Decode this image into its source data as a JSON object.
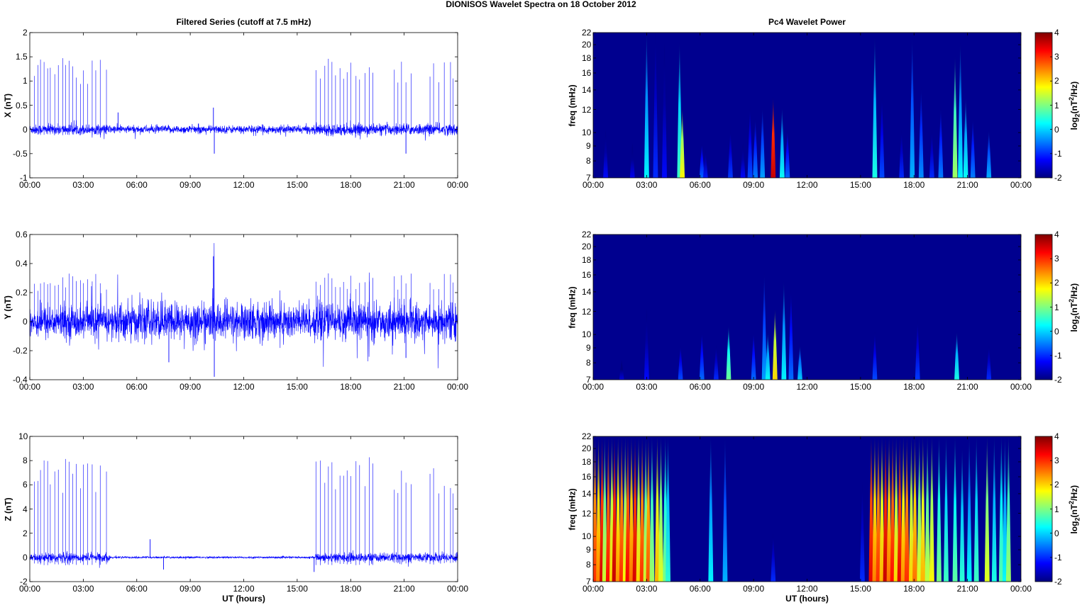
{
  "figure_title": "DIONISOS Wavelet Spectra on 18 October   2012",
  "colors": {
    "trace": "#0000ff",
    "background_power": "#00008f"
  },
  "chart_data": [
    {
      "type": "line",
      "id": "x_series",
      "title": "Filtered Series (cutoff at 7.5 mHz)",
      "xlabel": "",
      "ylabel": "X (nT)",
      "xlim": [
        0,
        24
      ],
      "ylim": [
        -1,
        2
      ],
      "yticks": [
        "-1",
        "-0.5",
        "0",
        "0.5",
        "1",
        "1.5",
        "2"
      ],
      "ytick_values": [
        -1,
        -0.5,
        0,
        0.5,
        1,
        1.5,
        2
      ],
      "xticks": [
        "00:00",
        "03:00",
        "06:00",
        "09:00",
        "12:00",
        "15:00",
        "18:00",
        "21:00",
        "00:00"
      ],
      "noise_sd": [
        [
          0,
          4.5,
          0.05
        ],
        [
          4.5,
          16,
          0.04
        ],
        [
          16,
          24,
          0.055
        ]
      ],
      "spike_scale": 1.25,
      "extra_spikes": [
        [
          4.95,
          0.35
        ],
        [
          10.3,
          0.45
        ],
        [
          10.35,
          -0.5
        ],
        [
          21.1,
          -0.5
        ]
      ]
    },
    {
      "type": "line",
      "id": "y_series",
      "title": "",
      "xlabel": "",
      "ylabel": "Y (nT)",
      "xlim": [
        0,
        24
      ],
      "ylim": [
        -0.4,
        0.6
      ],
      "yticks": [
        "-0.4",
        "-0.2",
        "0",
        "0.2",
        "0.4",
        "0.6"
      ],
      "ytick_values": [
        -0.4,
        -0.2,
        0,
        0.2,
        0.4,
        0.6
      ],
      "xticks": [
        "00:00",
        "03:00",
        "06:00",
        "09:00",
        "12:00",
        "15:00",
        "18:00",
        "21:00",
        "00:00"
      ],
      "noise_sd": [
        [
          0,
          4.5,
          0.055
        ],
        [
          4.5,
          16,
          0.065
        ],
        [
          16,
          24,
          0.06
        ]
      ],
      "spike_scale": 0.28,
      "extra_spikes": [
        [
          10.3,
          0.45
        ],
        [
          10.35,
          -0.38
        ],
        [
          7.8,
          -0.28
        ],
        [
          21.1,
          -0.25
        ]
      ]
    },
    {
      "type": "line",
      "id": "z_series",
      "title": "",
      "xlabel": "UT (hours)",
      "ylabel": "Z (nT)",
      "xlim": [
        0,
        24
      ],
      "ylim": [
        -2,
        10
      ],
      "yticks": [
        "-2",
        "0",
        "2",
        "4",
        "6",
        "8",
        "10"
      ],
      "ytick_values": [
        -2,
        0,
        2,
        4,
        6,
        8,
        10
      ],
      "xticks": [
        "00:00",
        "03:00",
        "06:00",
        "09:00",
        "12:00",
        "15:00",
        "18:00",
        "21:00",
        "00:00"
      ],
      "noise_sd": [
        [
          0,
          4.5,
          0.18
        ],
        [
          4.5,
          16,
          0.04
        ],
        [
          16,
          24,
          0.18
        ]
      ],
      "spike_scale": 7.0,
      "extra_spikes": [
        [
          6.75,
          1.5
        ],
        [
          7.5,
          -1.0
        ],
        [
          15.95,
          -1.2
        ]
      ]
    },
    {
      "type": "heatmap",
      "id": "x_wavelet",
      "title": "Pc4 Wavelet Power",
      "xlabel": "",
      "ylabel": "freq (mHz)",
      "xlim": [
        0,
        24
      ],
      "ylim": [
        7,
        22
      ],
      "yticks": [
        "7",
        "8",
        "9",
        "10",
        "12",
        "14",
        "16",
        "18",
        "20",
        "22"
      ],
      "ytick_values": [
        7,
        8,
        9,
        10,
        12,
        14,
        16,
        18,
        20,
        22
      ],
      "xticks": [
        "00:00",
        "03:00",
        "06:00",
        "09:00",
        "12:00",
        "15:00",
        "18:00",
        "21:00",
        "00:00"
      ],
      "colorbar": {
        "label": "log2(nT2/Hz)",
        "range": [
          -2,
          4
        ],
        "ticks": [
          "-2",
          "-1",
          "0",
          "1",
          "2",
          "3",
          "4"
        ]
      },
      "bursts": [
        [
          0.7,
          10,
          -1.2
        ],
        [
          2.2,
          9,
          -1.3
        ],
        [
          3.0,
          22,
          0.2
        ],
        [
          3.5,
          22,
          -1.0
        ],
        [
          4.0,
          20,
          -1.2
        ],
        [
          4.85,
          20,
          0.6
        ],
        [
          5.0,
          12,
          1.8
        ],
        [
          6.1,
          9,
          -0.6
        ],
        [
          6.3,
          8.5,
          -1.1
        ],
        [
          7.7,
          10,
          -0.9
        ],
        [
          8.4,
          9,
          -1.2
        ],
        [
          8.8,
          12,
          -0.8
        ],
        [
          9.1,
          11,
          -0.5
        ],
        [
          9.5,
          12,
          -0.3
        ],
        [
          10.1,
          13,
          3.6
        ],
        [
          10.6,
          12,
          0.3
        ],
        [
          10.9,
          10,
          -0.6
        ],
        [
          15.8,
          21,
          0.4
        ],
        [
          16.2,
          13,
          -0.8
        ],
        [
          17.3,
          10,
          -1.0
        ],
        [
          17.9,
          21,
          -0.2
        ],
        [
          18.4,
          14,
          -0.4
        ],
        [
          19.0,
          10,
          -1.0
        ],
        [
          19.5,
          12,
          -0.5
        ],
        [
          20.3,
          18,
          1.2
        ],
        [
          20.6,
          20,
          0.2
        ],
        [
          20.9,
          13,
          0.3
        ],
        [
          21.3,
          11,
          -0.5
        ],
        [
          22.2,
          10,
          -0.2
        ]
      ]
    },
    {
      "type": "heatmap",
      "id": "y_wavelet",
      "title": "",
      "xlabel": "",
      "ylabel": "freq (mHz)",
      "xlim": [
        0,
        24
      ],
      "ylim": [
        7,
        22
      ],
      "yticks": [
        "7",
        "8",
        "9",
        "10",
        "12",
        "14",
        "16",
        "18",
        "20",
        "22"
      ],
      "ytick_values": [
        7,
        8,
        9,
        10,
        12,
        14,
        16,
        18,
        20,
        22
      ],
      "xticks": [
        "00:00",
        "03:00",
        "06:00",
        "09:00",
        "12:00",
        "15:00",
        "18:00",
        "21:00",
        "00:00"
      ],
      "colorbar": {
        "label": "log2(nT2/Hz)",
        "range": [
          -2,
          4
        ],
        "ticks": [
          "-2",
          "-1",
          "0",
          "1",
          "2",
          "3",
          "4"
        ]
      },
      "bursts": [
        [
          1.6,
          8,
          -1.4
        ],
        [
          3.0,
          12,
          -1.2
        ],
        [
          4.9,
          9,
          -0.8
        ],
        [
          6.1,
          10,
          -0.6
        ],
        [
          6.9,
          9,
          -1.0
        ],
        [
          7.6,
          10.5,
          0.9
        ],
        [
          9.0,
          10,
          -0.6
        ],
        [
          9.6,
          16,
          -0.3
        ],
        [
          9.8,
          10,
          0.3
        ],
        [
          10.2,
          12,
          2.0
        ],
        [
          10.7,
          15,
          0.2
        ],
        [
          11.1,
          14,
          -0.6
        ],
        [
          11.6,
          9,
          0.0
        ],
        [
          15.8,
          10,
          -0.8
        ],
        [
          18.2,
          11,
          -0.9
        ],
        [
          20.4,
          10,
          0.4
        ],
        [
          22.2,
          9,
          -1.0
        ]
      ]
    },
    {
      "type": "heatmap",
      "id": "z_wavelet",
      "title": "",
      "xlabel": "UT (hours)",
      "ylabel": "freq (mHz)",
      "xlim": [
        0,
        24
      ],
      "ylim": [
        7,
        22
      ],
      "yticks": [
        "7",
        "8",
        "9",
        "10",
        "12",
        "14",
        "16",
        "18",
        "20",
        "22"
      ],
      "ytick_values": [
        7,
        8,
        9,
        10,
        12,
        14,
        16,
        18,
        20,
        22
      ],
      "xticks": [
        "00:00",
        "03:00",
        "06:00",
        "09:00",
        "12:00",
        "15:00",
        "18:00",
        "21:00",
        "00:00"
      ],
      "colorbar": {
        "label": "log2(nT2/Hz)",
        "range": [
          -2,
          4
        ],
        "ticks": [
          "-2",
          "-1",
          "0",
          "1",
          "2",
          "3",
          "4"
        ]
      },
      "bursts": [
        [
          0.1,
          22,
          3.0
        ],
        [
          0.3,
          22,
          2.5
        ],
        [
          0.5,
          22,
          3.5
        ],
        [
          0.65,
          22,
          1.5
        ],
        [
          0.85,
          22,
          3.2
        ],
        [
          1.05,
          22,
          2.0
        ],
        [
          1.2,
          22,
          3.6
        ],
        [
          1.4,
          22,
          2.4
        ],
        [
          1.6,
          22,
          3.0
        ],
        [
          1.8,
          22,
          1.8
        ],
        [
          1.95,
          22,
          3.3
        ],
        [
          2.15,
          22,
          2.6
        ],
        [
          2.35,
          22,
          3.5
        ],
        [
          2.55,
          22,
          2.0
        ],
        [
          2.75,
          22,
          3.0
        ],
        [
          2.95,
          22,
          1.5
        ],
        [
          3.1,
          22,
          2.8
        ],
        [
          3.3,
          22,
          1.2
        ],
        [
          3.6,
          22,
          2.2
        ],
        [
          3.8,
          22,
          1.6
        ],
        [
          4.05,
          22,
          1.0
        ],
        [
          4.2,
          22,
          0.5
        ],
        [
          6.6,
          22,
          0.2
        ],
        [
          7.4,
          22,
          -0.2
        ],
        [
          10.1,
          10,
          -1.0
        ],
        [
          15.1,
          15,
          -1.0
        ],
        [
          15.6,
          22,
          3.4
        ],
        [
          15.8,
          22,
          2.5
        ],
        [
          16.0,
          22,
          3.0
        ],
        [
          16.2,
          22,
          2.2
        ],
        [
          16.4,
          22,
          3.6
        ],
        [
          16.6,
          22,
          2.6
        ],
        [
          16.8,
          22,
          3.2
        ],
        [
          17.0,
          22,
          2.0
        ],
        [
          17.2,
          22,
          3.4
        ],
        [
          17.4,
          22,
          2.4
        ],
        [
          17.6,
          22,
          3.0
        ],
        [
          17.85,
          22,
          2.0
        ],
        [
          18.05,
          22,
          2.6
        ],
        [
          18.3,
          22,
          1.6
        ],
        [
          18.5,
          22,
          2.2
        ],
        [
          18.75,
          22,
          1.4
        ],
        [
          19.0,
          22,
          1.8
        ],
        [
          19.4,
          22,
          1.0
        ],
        [
          19.8,
          22,
          0.6
        ],
        [
          20.3,
          22,
          0.8
        ],
        [
          20.7,
          20,
          0.5
        ],
        [
          21.1,
          22,
          0.2
        ],
        [
          21.5,
          22,
          0.6
        ],
        [
          22.1,
          22,
          1.6
        ],
        [
          22.5,
          22,
          0.4
        ],
        [
          22.9,
          22,
          0.8
        ],
        [
          23.1,
          22,
          0.3
        ],
        [
          23.3,
          22,
          1.2
        ]
      ]
    }
  ],
  "spike_times": [
    0.25,
    0.45,
    0.6,
    0.8,
    1.0,
    1.15,
    1.4,
    1.6,
    1.85,
    2.0,
    2.2,
    2.4,
    2.6,
    2.85,
    3.0,
    3.25,
    3.5,
    3.7,
    3.95,
    4.3,
    16.05,
    16.3,
    16.55,
    16.75,
    16.95,
    17.15,
    17.4,
    17.6,
    17.8,
    18.0,
    18.3,
    18.5,
    18.8,
    19.05,
    19.25,
    20.45,
    20.65,
    20.85,
    21.1,
    21.4,
    22.45,
    22.65,
    22.95,
    23.25,
    23.6,
    23.75
  ]
}
